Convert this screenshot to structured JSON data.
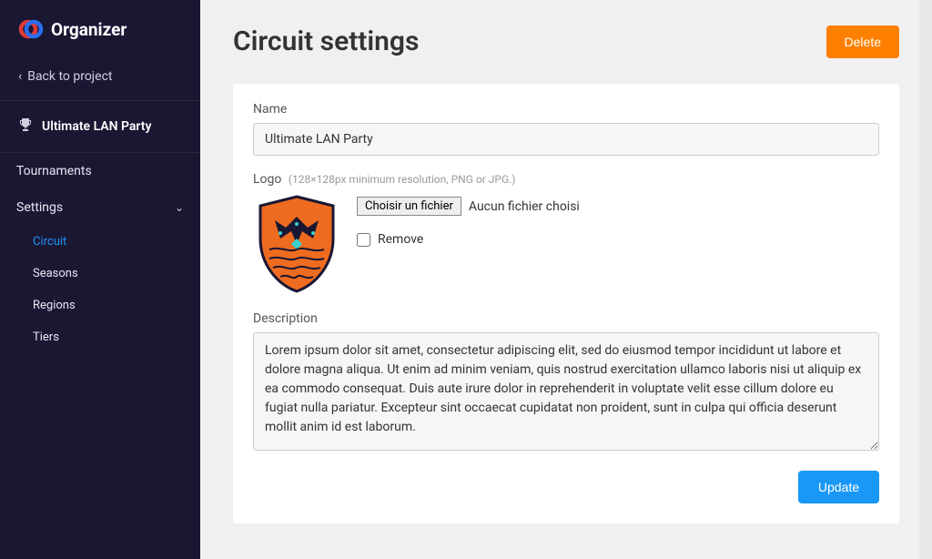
{
  "app": {
    "name": "Organizer"
  },
  "sidebar": {
    "back_label": "Back to project",
    "project_name": "Ultimate LAN Party",
    "nav": {
      "tournaments": "Tournaments",
      "settings": "Settings",
      "sub": {
        "circuit": "Circuit",
        "seasons": "Seasons",
        "regions": "Regions",
        "tiers": "Tiers"
      }
    }
  },
  "page": {
    "title": "Circuit settings",
    "delete_label": "Delete",
    "update_label": "Update"
  },
  "form": {
    "name_label": "Name",
    "name_value": "Ultimate LAN Party",
    "logo_label": "Logo",
    "logo_hint": "(128×128px minimum resolution, PNG or JPG.)",
    "file_button": "Choisir un fichier",
    "file_none": "Aucun fichier choisi",
    "remove_label": "Remove",
    "description_label": "Description",
    "description_value": "Lorem ipsum dolor sit amet, consectetur adipiscing elit, sed do eiusmod tempor incididunt ut labore et dolore magna aliqua. Ut enim ad minim veniam, quis nostrud exercitation ullamco laboris nisi ut aliquip ex ea commodo consequat. Duis aute irure dolor in reprehenderit in voluptate velit esse cillum dolore eu fugiat nulla pariatur. Excepteur sint occaecat cupidatat non proident, sunt in culpa qui officia deserunt mollit anim id est laborum."
  },
  "colors": {
    "sidebar_bg": "#1a1733",
    "accent_orange": "#ff8000",
    "accent_blue": "#1998f7",
    "link_blue": "#2196f3"
  }
}
